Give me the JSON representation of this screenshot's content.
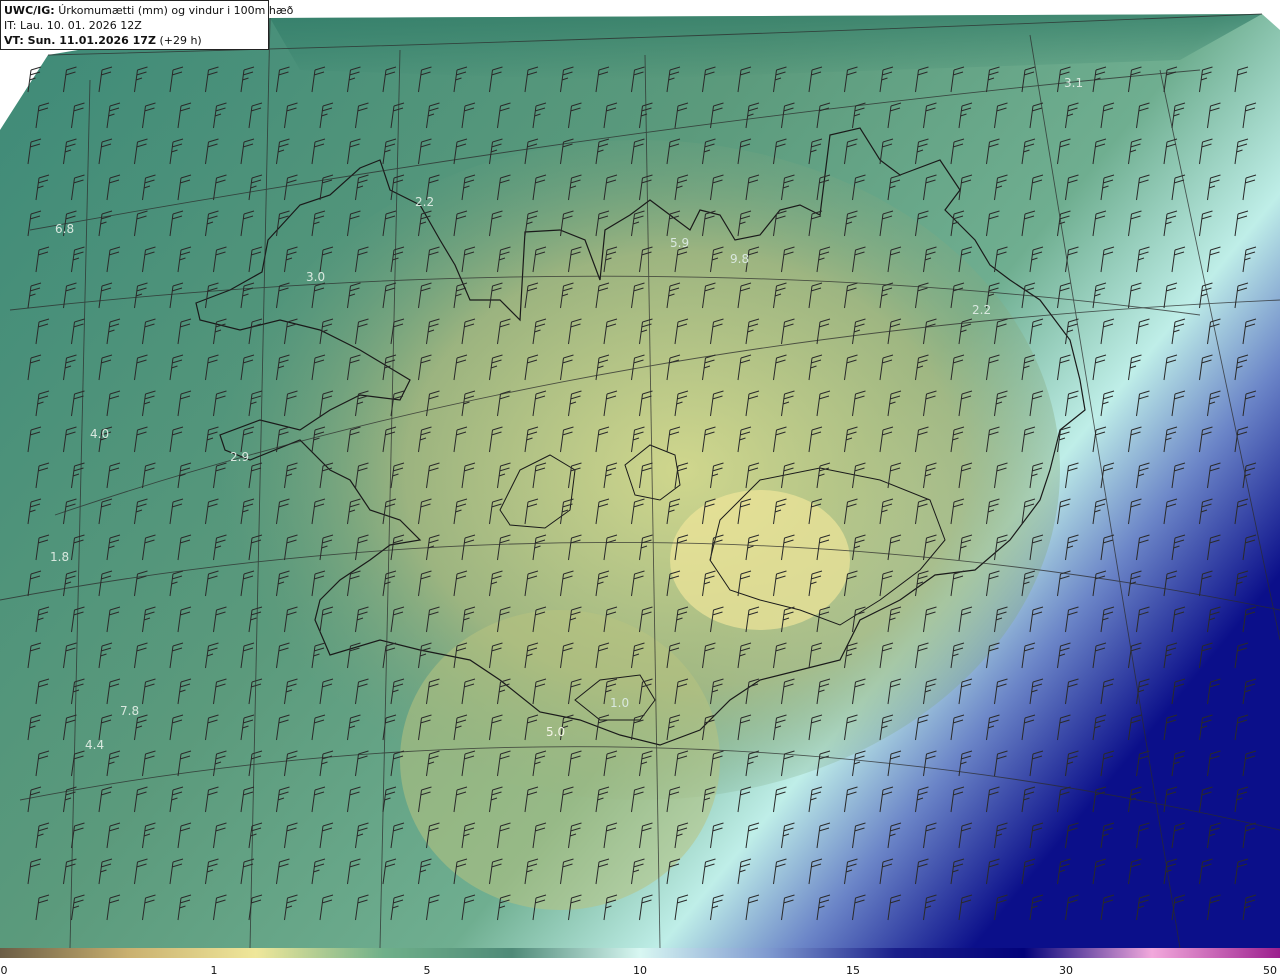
{
  "header": {
    "model": "UWC/IG:",
    "field": "Úrkomumætti (mm) og vindur i 100m hæð",
    "initial_time": "IT: Lau. 10. 01. 2026 12Z",
    "valid_time_label": "VT: Sun. 11.01.2026 17Z",
    "valid_time_offset": "(+29 h)"
  },
  "map_labels": [
    {
      "text": "3.1"
    },
    {
      "text": "2.2"
    },
    {
      "text": "6.8"
    },
    {
      "text": "3.0"
    },
    {
      "text": "5.9"
    },
    {
      "text": "9.8"
    },
    {
      "text": "4.0"
    },
    {
      "text": "2.9"
    },
    {
      "text": "1.8"
    },
    {
      "text": "7.8"
    },
    {
      "text": "4.4"
    },
    {
      "text": "5.0"
    },
    {
      "text": "1.0"
    },
    {
      "text": "2.2"
    }
  ],
  "colorbar": {
    "ticks": [
      "0",
      "1",
      "5",
      "10",
      "15",
      "30",
      "50"
    ],
    "colors": [
      "#6b5d45",
      "#c9b06f",
      "#efe79a",
      "#6fb08a",
      "#4f8a78",
      "#d8f7f2",
      "#7f9ad0",
      "#1a1f8a",
      "#02027a",
      "#f2a9dc",
      "#9c1f8e"
    ]
  }
}
